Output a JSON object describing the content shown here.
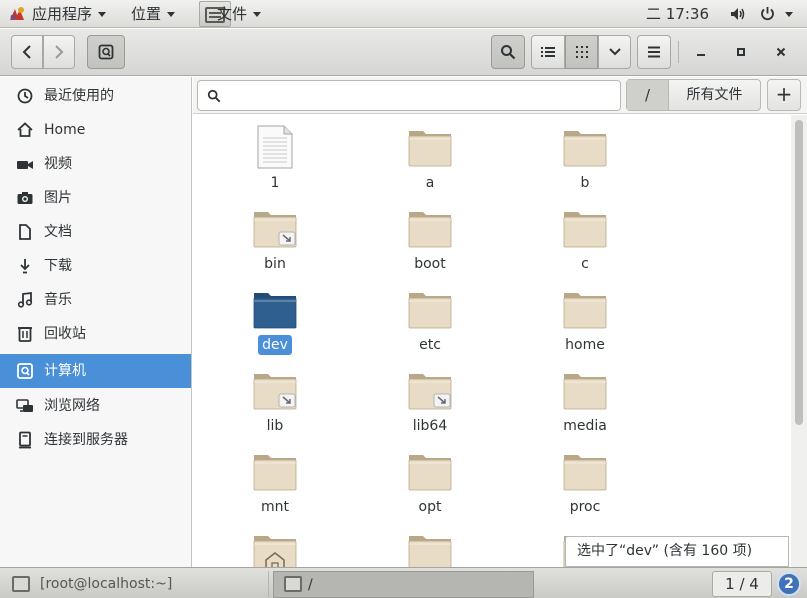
{
  "top_panel": {
    "apps_label": "应用程序",
    "places_label": "位置",
    "files_label": "文件",
    "clock": "二 17:36"
  },
  "toolbar": {
    "back_icon": "go-back-icon",
    "forward_icon": "go-forward-icon",
    "location_icon": "computer-location-icon",
    "search_icon": "search-icon",
    "list_view_icon": "list-view-icon",
    "grid_view_icon": "grid-view-icon",
    "view_options_icon": "chevron-down-icon",
    "menu_icon": "hamburger-menu-icon",
    "minimize_icon": "minimize-icon",
    "maximize_icon": "maximize-icon",
    "close_icon": "close-icon"
  },
  "sidebar": {
    "items": [
      {
        "label": "最近使用的",
        "icon": "clock-icon"
      },
      {
        "label": "Home",
        "icon": "home-icon"
      },
      {
        "label": "视频",
        "icon": "video-camera-icon"
      },
      {
        "label": "图片",
        "icon": "camera-icon"
      },
      {
        "label": "文档",
        "icon": "document-icon"
      },
      {
        "label": "下载",
        "icon": "download-icon"
      },
      {
        "label": "音乐",
        "icon": "music-icon"
      },
      {
        "label": "回收站",
        "icon": "trash-icon"
      },
      {
        "label": "计算机",
        "icon": "computer-drive-icon",
        "active": true
      },
      {
        "label": "浏览网络",
        "icon": "network-icon"
      },
      {
        "label": "连接到服务器",
        "icon": "server-icon"
      }
    ]
  },
  "location_bar": {
    "search_placeholder": "",
    "path_root": "/",
    "path_current": "所有文件",
    "add_label": "+"
  },
  "files": [
    {
      "name": "1",
      "type": "text-file"
    },
    {
      "name": "a",
      "type": "folder"
    },
    {
      "name": "b",
      "type": "folder"
    },
    {
      "name": "bin",
      "type": "folder-link"
    },
    {
      "name": "boot",
      "type": "folder"
    },
    {
      "name": "c",
      "type": "folder"
    },
    {
      "name": "dev",
      "type": "folder-selected",
      "selected": true
    },
    {
      "name": "etc",
      "type": "folder"
    },
    {
      "name": "home",
      "type": "folder"
    },
    {
      "name": "lib",
      "type": "folder-link"
    },
    {
      "name": "lib64",
      "type": "folder-link"
    },
    {
      "name": "media",
      "type": "folder"
    },
    {
      "name": "mnt",
      "type": "folder"
    },
    {
      "name": "opt",
      "type": "folder"
    },
    {
      "name": "proc",
      "type": "folder"
    },
    {
      "name": "",
      "type": "folder-home"
    },
    {
      "name": "",
      "type": "folder"
    },
    {
      "name": "",
      "type": "folder"
    }
  ],
  "status_text": "选中了“dev” (含有 160 项)",
  "bottom_panel": {
    "task_terminal": "[root@localhost:~]",
    "task_files": "/",
    "workspace": "1 / 4",
    "notification_count": "2"
  },
  "colors": {
    "accent": "#4a90d9",
    "folder": "#e8dcc6",
    "folder_selected": "#2f5f8f"
  }
}
